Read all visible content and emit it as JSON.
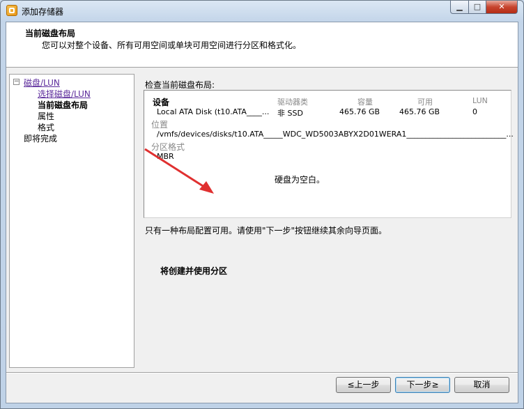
{
  "window": {
    "title": "添加存储器",
    "minimize_glyph": "▁",
    "maximize_glyph": "□",
    "close_glyph": "✕"
  },
  "header": {
    "title": "当前磁盘布局",
    "subtitle": "您可以对整个设备、所有可用空间或单块可用空间进行分区和格式化。"
  },
  "nav": {
    "expand_glyph": "−",
    "items": [
      {
        "label": "磁盘/LUN",
        "style": "link"
      },
      {
        "label": "选择磁盘/LUN",
        "style": "link"
      },
      {
        "label": "当前磁盘布局",
        "style": "current"
      },
      {
        "label": "属性",
        "style": "normal"
      },
      {
        "label": "格式",
        "style": "normal"
      },
      {
        "label": "即将完成",
        "style": "normal"
      }
    ]
  },
  "main": {
    "section_label": "检查当前磁盘布局:",
    "table": {
      "headers": {
        "device": "设备",
        "drive_type": "驱动器类",
        "capacity": "容量",
        "available": "可用",
        "lun": "LUN"
      },
      "row": {
        "device": "Local ATA Disk (t10.ATA____...",
        "drive_type": "非 SSD",
        "capacity": "465.76 GB",
        "available": "465.76 GB",
        "lun": "0"
      },
      "location_label": "位置",
      "location_value": "/vmfs/devices/disks/t10.ATA_____WDC_WD5003ABYX2D01WERA1__________________________...",
      "partition_format_label": "分区格式",
      "partition_format_value": "MBR",
      "empty_message": "硬盘为空白。"
    },
    "info_text": "只有一种布局配置可用。请使用\"下一步\"按钮继续其余向导页面。",
    "partition_text": "将创建并使用分区"
  },
  "footer": {
    "back_label": "≤上一步",
    "next_label": "下一步≥",
    "cancel_label": "取消"
  },
  "colors": {
    "arrow": "#e03030",
    "nav_link": "#5b2a9b",
    "header_gray": "#888888"
  }
}
